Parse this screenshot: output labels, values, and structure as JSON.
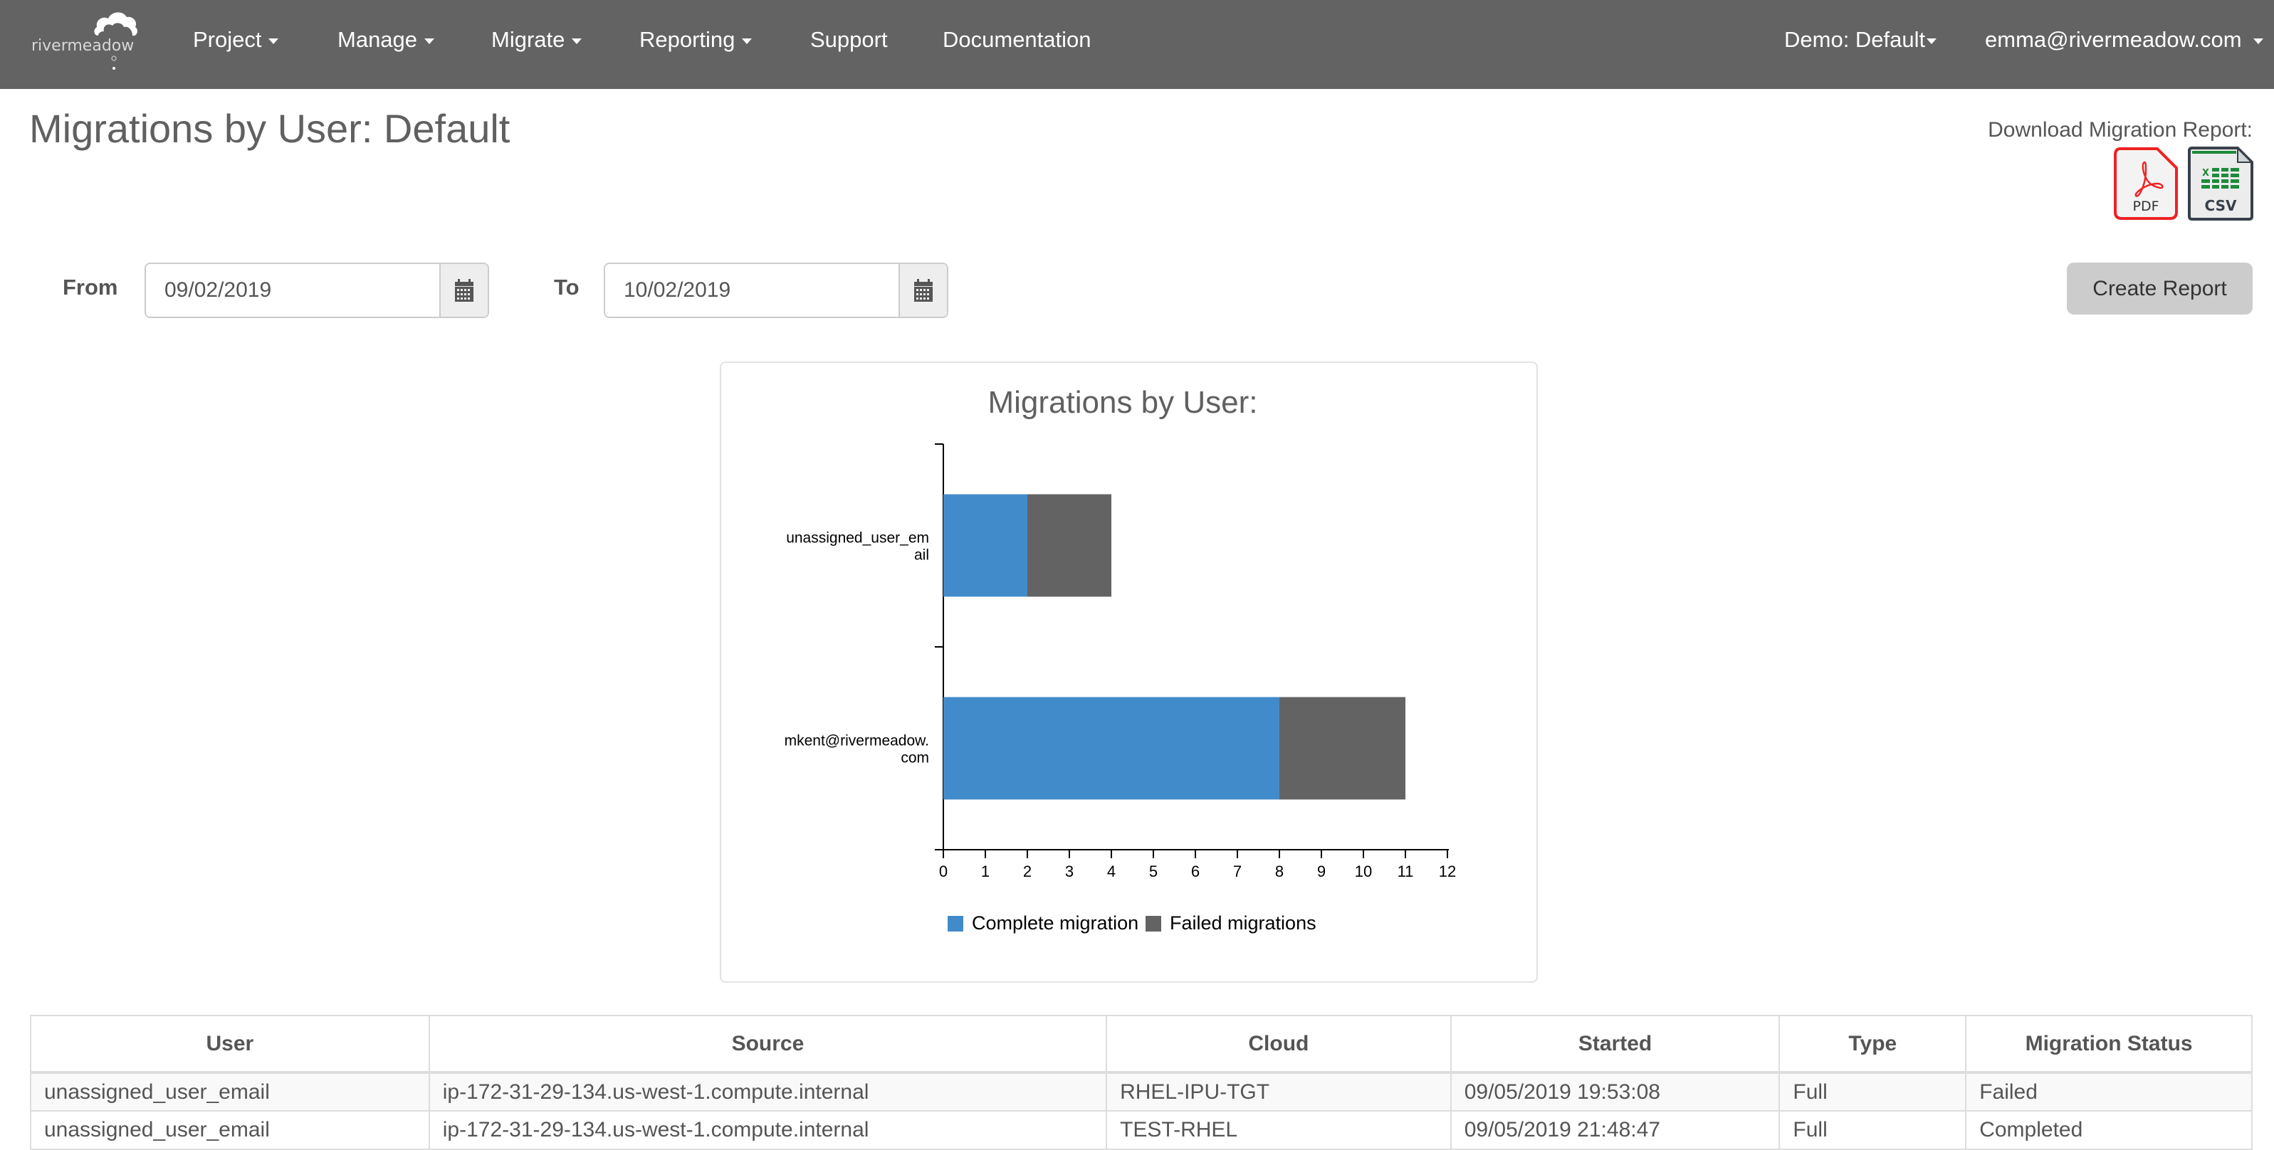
{
  "navbar": {
    "logo_text": "rivermeadow",
    "items": [
      {
        "label": "Project",
        "dropdown": true
      },
      {
        "label": "Manage",
        "dropdown": true
      },
      {
        "label": "Migrate",
        "dropdown": true
      },
      {
        "label": "Reporting",
        "dropdown": true
      },
      {
        "label": "Support",
        "dropdown": false
      },
      {
        "label": "Documentation",
        "dropdown": false
      }
    ],
    "org_selector": "Demo: Default",
    "user_menu": "emma@rivermeadow.com"
  },
  "header": {
    "title": "Migrations by User: Default",
    "download_label": "Download Migration Report:",
    "pdf_label": "PDF",
    "csv_label": "CSV"
  },
  "filter": {
    "from_label": "From",
    "from_value": "09/02/2019",
    "to_label": "To",
    "to_value": "10/02/2019",
    "create_report_label": "Create Report"
  },
  "colors": {
    "navbar_bg": "#636363",
    "complete": "#428bca",
    "failed": "#636363",
    "pdf_red": "#ee2222",
    "csv_green": "#1e8a3a",
    "csv_dark": "#37404a"
  },
  "chart_data": {
    "type": "bar",
    "orientation": "horizontal",
    "stacked": true,
    "title": "Migrations by User:",
    "categories": [
      "unassigned_user_email",
      "mkent@rivermeadow.com"
    ],
    "category_label_lines": [
      [
        "unassigned_user_em",
        "ail"
      ],
      [
        "mkent@rivermeadow.",
        "com"
      ]
    ],
    "series": [
      {
        "name": "Complete migrations",
        "legend_label": "Complete migration",
        "values": [
          2,
          8
        ],
        "color": "#428bca"
      },
      {
        "name": "Failed migrations",
        "legend_label": "Failed migrations",
        "values": [
          2,
          3
        ],
        "color": "#636363"
      }
    ],
    "xlabel": "",
    "ylabel": "",
    "xlim": [
      0,
      12
    ],
    "xticks": [
      "0",
      "1",
      "2",
      "3",
      "4",
      "5",
      "6",
      "7",
      "8",
      "9",
      "10",
      "11",
      "12"
    ],
    "grid": false,
    "legend": "bottom"
  },
  "table": {
    "columns": [
      "User",
      "Source",
      "Cloud",
      "Started",
      "Type",
      "Migration Status"
    ],
    "rows": [
      [
        "unassigned_user_email",
        "ip-172-31-29-134.us-west-1.compute.internal",
        "RHEL-IPU-TGT",
        "09/05/2019 19:53:08",
        "Full",
        "Failed"
      ],
      [
        "unassigned_user_email",
        "ip-172-31-29-134.us-west-1.compute.internal",
        "TEST-RHEL",
        "09/05/2019 21:48:47",
        "Full",
        "Completed"
      ]
    ]
  }
}
